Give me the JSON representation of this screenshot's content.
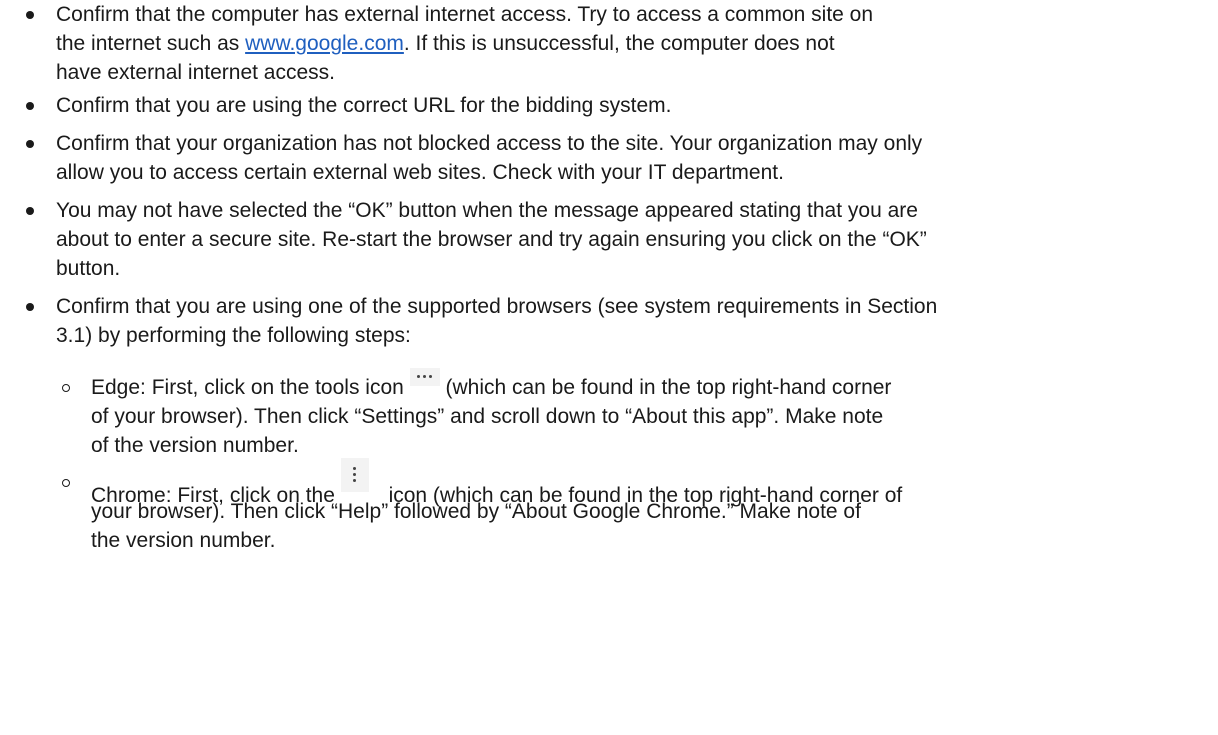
{
  "bullets": [
    {
      "lines": [
        {
          "pre": "Confirm that the computer has external internet access.  Try to access a common site on"
        },
        {
          "pre": "the internet such as ",
          "link": "www.google.com",
          "post": ".  If this is unsuccessful, the computer does not"
        },
        {
          "pre": "have external internet access."
        }
      ]
    },
    {
      "lines": [
        {
          "pre": "Confirm that you are using the correct URL for the bidding system."
        }
      ]
    },
    {
      "lines": [
        {
          "pre": "Confirm that your organization has not blocked access to the site.  Your organization may only"
        },
        {
          "pre": "allow you to access certain external web sites.  Check with your IT department."
        }
      ]
    },
    {
      "lines": [
        {
          "pre": "You may not have selected the “OK” button when the message appeared stating that you are"
        },
        {
          "pre": "about to enter a secure site.  Re-start the browser and try again ensuring you click on the “OK”"
        },
        {
          "pre": "button."
        }
      ]
    },
    {
      "lines": [
        {
          "pre": "Confirm that you are using one of the supported browsers (see system requirements in Section"
        },
        {
          "pre": "3.1) by performing the following steps:"
        }
      ]
    }
  ],
  "sub_bullets": [
    {
      "lines": [
        {
          "pre": "Edge:  First, click on the tools icon ",
          "icon": "more-horizontal-icon",
          "post": " (which can be found in the top right-hand corner"
        },
        {
          "pre": "of your browser).  Then click “Settings” and scroll down to “About this app”.  Make note"
        },
        {
          "pre": "of the version number."
        }
      ]
    },
    {
      "lines": [
        {
          "pre": "Chrome:  First, click on the ",
          "icon": "more-vertical-icon",
          "post": " icon (which can be found in the top right-hand corner of"
        },
        {
          "pre": "your browser).  Then click “Help” followed by “About Google Chrome.”  Make note of"
        },
        {
          "pre": "the version number."
        }
      ]
    }
  ]
}
